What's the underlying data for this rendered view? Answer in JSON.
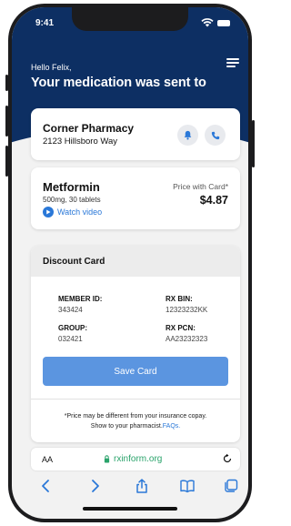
{
  "status": {
    "time": "9:41"
  },
  "header": {
    "greeting": "Hello Felix,",
    "title": "Your medication was sent to"
  },
  "pharmacy": {
    "name": "Corner Pharmacy",
    "address": "2123 Hillsboro Way"
  },
  "medication": {
    "name": "Metformin",
    "dose": "500mg, 30 tablets",
    "watch_video": "Watch video",
    "price_label": "Price with Card*",
    "price": "$4.87"
  },
  "discount_card": {
    "title": "Discount Card",
    "member_id_label": "MEMBER ID:",
    "member_id": "343424",
    "rx_bin_label": "RX BIN:",
    "rx_bin": "12323232KK",
    "group_label": "GROUP:",
    "group": "032421",
    "rx_pcn_label": "RX PCN:",
    "rx_pcn": "AA23232323",
    "save_button": "Save Card",
    "disclaimer_line1": "*Price may be different from your insurance copay.",
    "disclaimer_line2": "Show to your pharmacist.",
    "faq_link": "FAQs."
  },
  "browser": {
    "text_size": "AA",
    "url": "rxinform.org"
  },
  "colors": {
    "header_navy": "#0d2f63",
    "accent_blue": "#2a78d8",
    "save_button": "#5b95e0",
    "url_green": "#2aa36b"
  },
  "icons": [
    "menu-icon",
    "bell-icon",
    "phone-icon",
    "play-icon",
    "lock-icon",
    "reload-icon",
    "back-icon",
    "forward-icon",
    "share-icon",
    "bookmarks-icon",
    "tabs-icon"
  ]
}
